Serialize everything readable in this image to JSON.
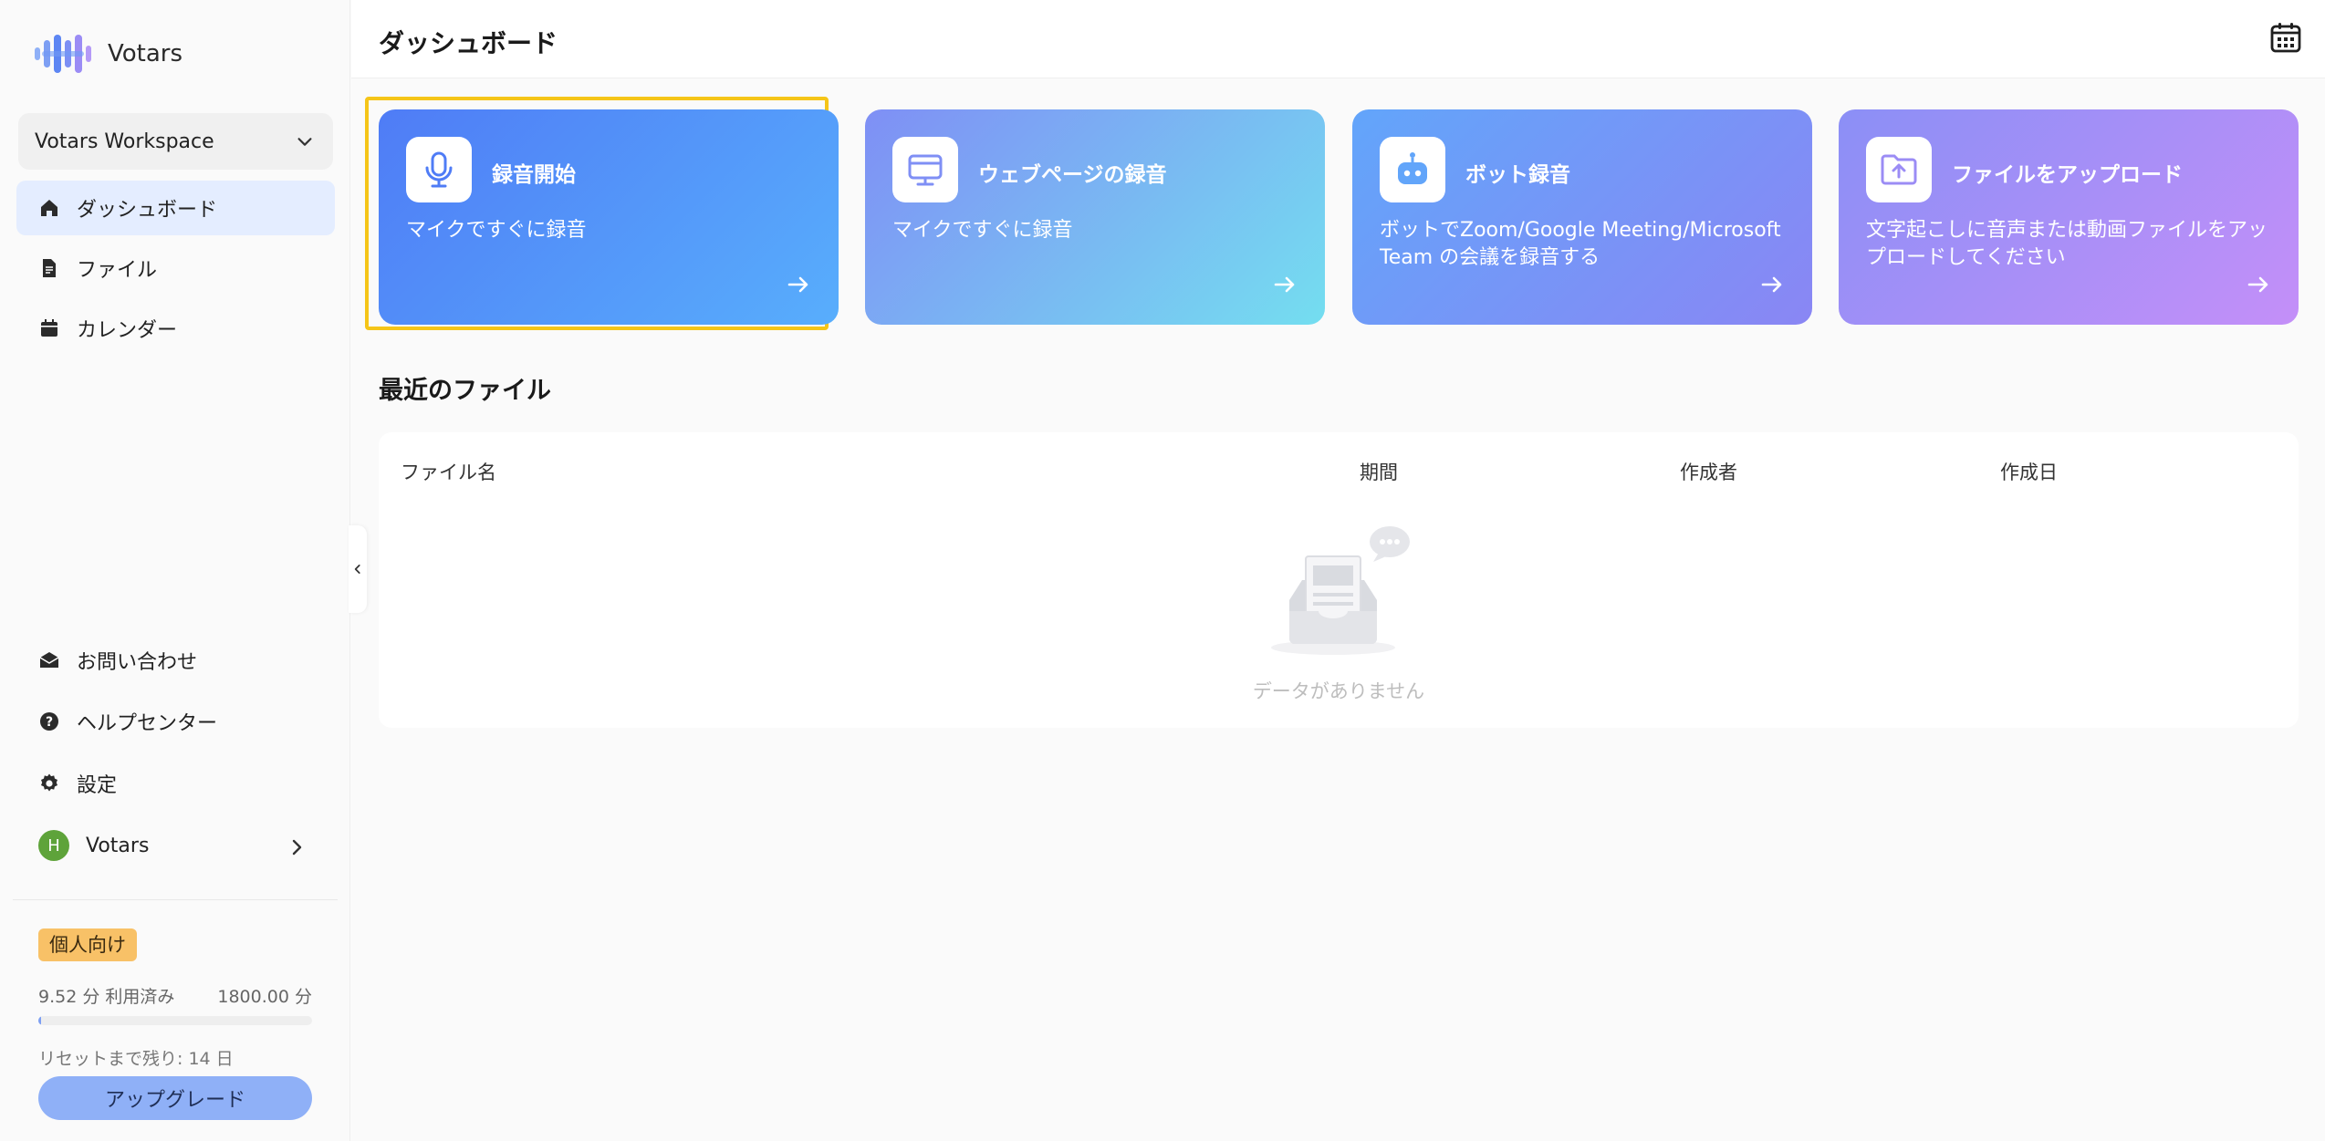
{
  "app": {
    "logo_text": "Votars",
    "brand_color": "#4f7cf6"
  },
  "sidebar": {
    "workspace": "Votars Workspace",
    "nav": [
      {
        "label": "ダッシュボード",
        "icon": "home-icon",
        "active": true
      },
      {
        "label": "ファイル",
        "icon": "file-icon",
        "active": false
      },
      {
        "label": "カレンダー",
        "icon": "calendar-icon",
        "active": false
      }
    ],
    "bottom": [
      {
        "label": "お問い合わせ",
        "icon": "mail-icon"
      },
      {
        "label": "ヘルプセンター",
        "icon": "help-icon"
      },
      {
        "label": "設定",
        "icon": "gear-icon"
      }
    ],
    "user": {
      "initial": "H",
      "name": "Votars"
    },
    "plan": {
      "badge": "個人向け",
      "used": "9.52 分 利用済み",
      "total": "1800.00 分",
      "used_fraction": 0.0053,
      "reset": "リセットまで残り: 14 日",
      "upgrade_label": "アップグレード"
    }
  },
  "header": {
    "title": "ダッシュボード",
    "calendar_icon": "calendar-grid-icon"
  },
  "cards": [
    {
      "title": "録音開始",
      "desc": "マイクですぐに録音",
      "icon": "microphone-icon"
    },
    {
      "title": "ウェブページの録音",
      "desc": "マイクですぐに録音",
      "icon": "monitor-icon"
    },
    {
      "title": "ボット録音",
      "desc": "ボットでZoom/Google Meeting/Microsoft Team の会議を録音する",
      "icon": "robot-icon"
    },
    {
      "title": "ファイルをアップロード",
      "desc": "文字起こしに音声または動画ファイルをアップロードしてください",
      "icon": "folder-upload-icon"
    }
  ],
  "recent": {
    "title": "最近のファイル",
    "columns": [
      "ファイル名",
      "期間",
      "作成者",
      "作成日"
    ],
    "empty_text": "データがありません"
  }
}
